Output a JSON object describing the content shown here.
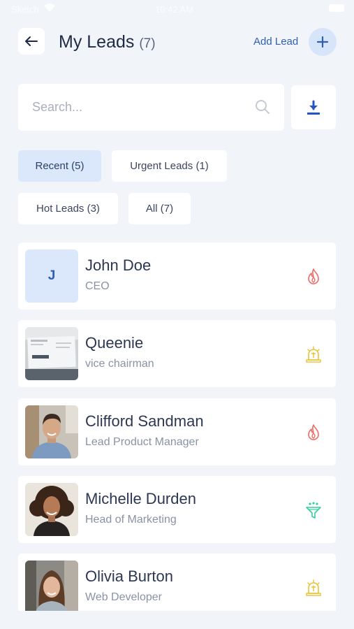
{
  "status_bar": {
    "carrier": "Sketch",
    "time": "10:42 AM"
  },
  "header": {
    "title": "My Leads",
    "count": "(7)",
    "add_lead_label": "Add Lead"
  },
  "search": {
    "placeholder": "Search...",
    "value": ""
  },
  "filters": [
    {
      "label": "Recent (5)",
      "active": true
    },
    {
      "label": "Urgent Leads (1)",
      "active": false
    },
    {
      "label": "Hot Leads (3)",
      "active": false
    },
    {
      "label": "All (7)",
      "active": false
    }
  ],
  "leads": [
    {
      "name": "John Doe",
      "role": "CEO",
      "initial": "J",
      "avatar": "initial",
      "status_icon": "flame-icon",
      "status_color": "#ef6b63"
    },
    {
      "name": "Queenie",
      "role": "vice chairman",
      "avatar": "business-card-photo",
      "status_icon": "alarm-icon",
      "status_color": "#e9c233"
    },
    {
      "name": "Clifford Sandman",
      "role": "Lead Product Manager",
      "avatar": "man-photo",
      "status_icon": "flame-icon",
      "status_color": "#ef6b63"
    },
    {
      "name": "Michelle Durden",
      "role": "Head of Marketing",
      "avatar": "woman-curly-photo",
      "status_icon": "funnel-icon",
      "status_color": "#33d19a"
    },
    {
      "name": "Olivia Burton",
      "role": "Web Developer",
      "avatar": "woman-photo",
      "status_icon": "alarm-icon",
      "status_color": "#e9c233"
    }
  ],
  "colors": {
    "background": "#f1f4f9",
    "accent": "#2f5fb3",
    "active_chip": "#dbe8fb",
    "hot": "#ef6b63",
    "urgent": "#e9c233",
    "funnel": "#33d19a"
  }
}
